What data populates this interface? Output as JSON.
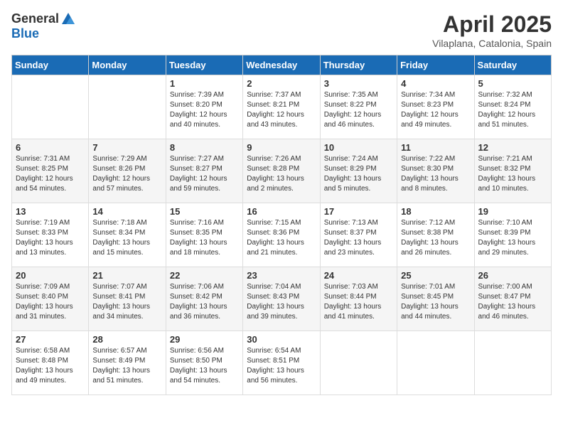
{
  "header": {
    "logo_general": "General",
    "logo_blue": "Blue",
    "title": "April 2025",
    "location": "Vilaplana, Catalonia, Spain"
  },
  "columns": [
    "Sunday",
    "Monday",
    "Tuesday",
    "Wednesday",
    "Thursday",
    "Friday",
    "Saturday"
  ],
  "weeks": [
    {
      "shade": "white",
      "days": [
        {
          "num": "",
          "info": ""
        },
        {
          "num": "",
          "info": ""
        },
        {
          "num": "1",
          "info": "Sunrise: 7:39 AM\nSunset: 8:20 PM\nDaylight: 12 hours\nand 40 minutes."
        },
        {
          "num": "2",
          "info": "Sunrise: 7:37 AM\nSunset: 8:21 PM\nDaylight: 12 hours\nand 43 minutes."
        },
        {
          "num": "3",
          "info": "Sunrise: 7:35 AM\nSunset: 8:22 PM\nDaylight: 12 hours\nand 46 minutes."
        },
        {
          "num": "4",
          "info": "Sunrise: 7:34 AM\nSunset: 8:23 PM\nDaylight: 12 hours\nand 49 minutes."
        },
        {
          "num": "5",
          "info": "Sunrise: 7:32 AM\nSunset: 8:24 PM\nDaylight: 12 hours\nand 51 minutes."
        }
      ]
    },
    {
      "shade": "gray",
      "days": [
        {
          "num": "6",
          "info": "Sunrise: 7:31 AM\nSunset: 8:25 PM\nDaylight: 12 hours\nand 54 minutes."
        },
        {
          "num": "7",
          "info": "Sunrise: 7:29 AM\nSunset: 8:26 PM\nDaylight: 12 hours\nand 57 minutes."
        },
        {
          "num": "8",
          "info": "Sunrise: 7:27 AM\nSunset: 8:27 PM\nDaylight: 12 hours\nand 59 minutes."
        },
        {
          "num": "9",
          "info": "Sunrise: 7:26 AM\nSunset: 8:28 PM\nDaylight: 13 hours\nand 2 minutes."
        },
        {
          "num": "10",
          "info": "Sunrise: 7:24 AM\nSunset: 8:29 PM\nDaylight: 13 hours\nand 5 minutes."
        },
        {
          "num": "11",
          "info": "Sunrise: 7:22 AM\nSunset: 8:30 PM\nDaylight: 13 hours\nand 8 minutes."
        },
        {
          "num": "12",
          "info": "Sunrise: 7:21 AM\nSunset: 8:32 PM\nDaylight: 13 hours\nand 10 minutes."
        }
      ]
    },
    {
      "shade": "white",
      "days": [
        {
          "num": "13",
          "info": "Sunrise: 7:19 AM\nSunset: 8:33 PM\nDaylight: 13 hours\nand 13 minutes."
        },
        {
          "num": "14",
          "info": "Sunrise: 7:18 AM\nSunset: 8:34 PM\nDaylight: 13 hours\nand 15 minutes."
        },
        {
          "num": "15",
          "info": "Sunrise: 7:16 AM\nSunset: 8:35 PM\nDaylight: 13 hours\nand 18 minutes."
        },
        {
          "num": "16",
          "info": "Sunrise: 7:15 AM\nSunset: 8:36 PM\nDaylight: 13 hours\nand 21 minutes."
        },
        {
          "num": "17",
          "info": "Sunrise: 7:13 AM\nSunset: 8:37 PM\nDaylight: 13 hours\nand 23 minutes."
        },
        {
          "num": "18",
          "info": "Sunrise: 7:12 AM\nSunset: 8:38 PM\nDaylight: 13 hours\nand 26 minutes."
        },
        {
          "num": "19",
          "info": "Sunrise: 7:10 AM\nSunset: 8:39 PM\nDaylight: 13 hours\nand 29 minutes."
        }
      ]
    },
    {
      "shade": "gray",
      "days": [
        {
          "num": "20",
          "info": "Sunrise: 7:09 AM\nSunset: 8:40 PM\nDaylight: 13 hours\nand 31 minutes."
        },
        {
          "num": "21",
          "info": "Sunrise: 7:07 AM\nSunset: 8:41 PM\nDaylight: 13 hours\nand 34 minutes."
        },
        {
          "num": "22",
          "info": "Sunrise: 7:06 AM\nSunset: 8:42 PM\nDaylight: 13 hours\nand 36 minutes."
        },
        {
          "num": "23",
          "info": "Sunrise: 7:04 AM\nSunset: 8:43 PM\nDaylight: 13 hours\nand 39 minutes."
        },
        {
          "num": "24",
          "info": "Sunrise: 7:03 AM\nSunset: 8:44 PM\nDaylight: 13 hours\nand 41 minutes."
        },
        {
          "num": "25",
          "info": "Sunrise: 7:01 AM\nSunset: 8:45 PM\nDaylight: 13 hours\nand 44 minutes."
        },
        {
          "num": "26",
          "info": "Sunrise: 7:00 AM\nSunset: 8:47 PM\nDaylight: 13 hours\nand 46 minutes."
        }
      ]
    },
    {
      "shade": "white",
      "days": [
        {
          "num": "27",
          "info": "Sunrise: 6:58 AM\nSunset: 8:48 PM\nDaylight: 13 hours\nand 49 minutes."
        },
        {
          "num": "28",
          "info": "Sunrise: 6:57 AM\nSunset: 8:49 PM\nDaylight: 13 hours\nand 51 minutes."
        },
        {
          "num": "29",
          "info": "Sunrise: 6:56 AM\nSunset: 8:50 PM\nDaylight: 13 hours\nand 54 minutes."
        },
        {
          "num": "30",
          "info": "Sunrise: 6:54 AM\nSunset: 8:51 PM\nDaylight: 13 hours\nand 56 minutes."
        },
        {
          "num": "",
          "info": ""
        },
        {
          "num": "",
          "info": ""
        },
        {
          "num": "",
          "info": ""
        }
      ]
    }
  ]
}
